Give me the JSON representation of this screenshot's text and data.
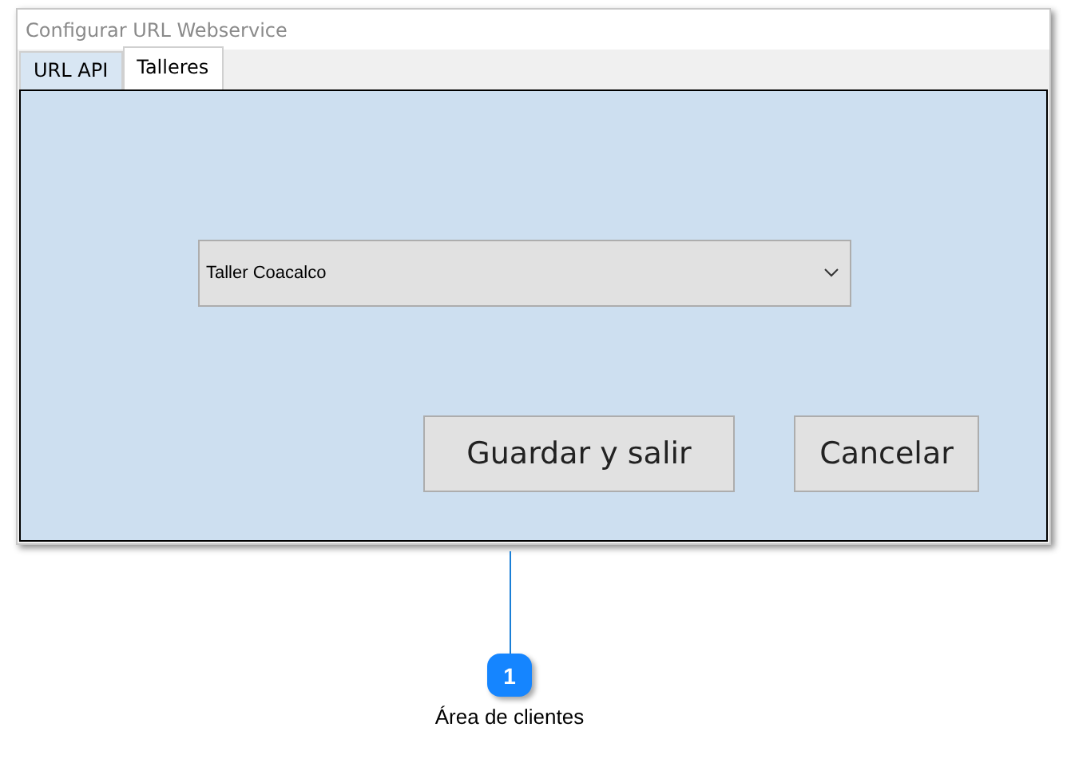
{
  "window": {
    "title": "Configurar URL Webservice"
  },
  "tabs": [
    {
      "label": "URL API",
      "selected": false
    },
    {
      "label": "Talleres",
      "selected": true
    }
  ],
  "workshop_select": {
    "value": "Taller Coacalco"
  },
  "buttons": [
    {
      "label": "Guardar y salir"
    },
    {
      "label": "Cancelar"
    }
  ],
  "callout": {
    "number": "1",
    "label": "Área de clientes"
  }
}
